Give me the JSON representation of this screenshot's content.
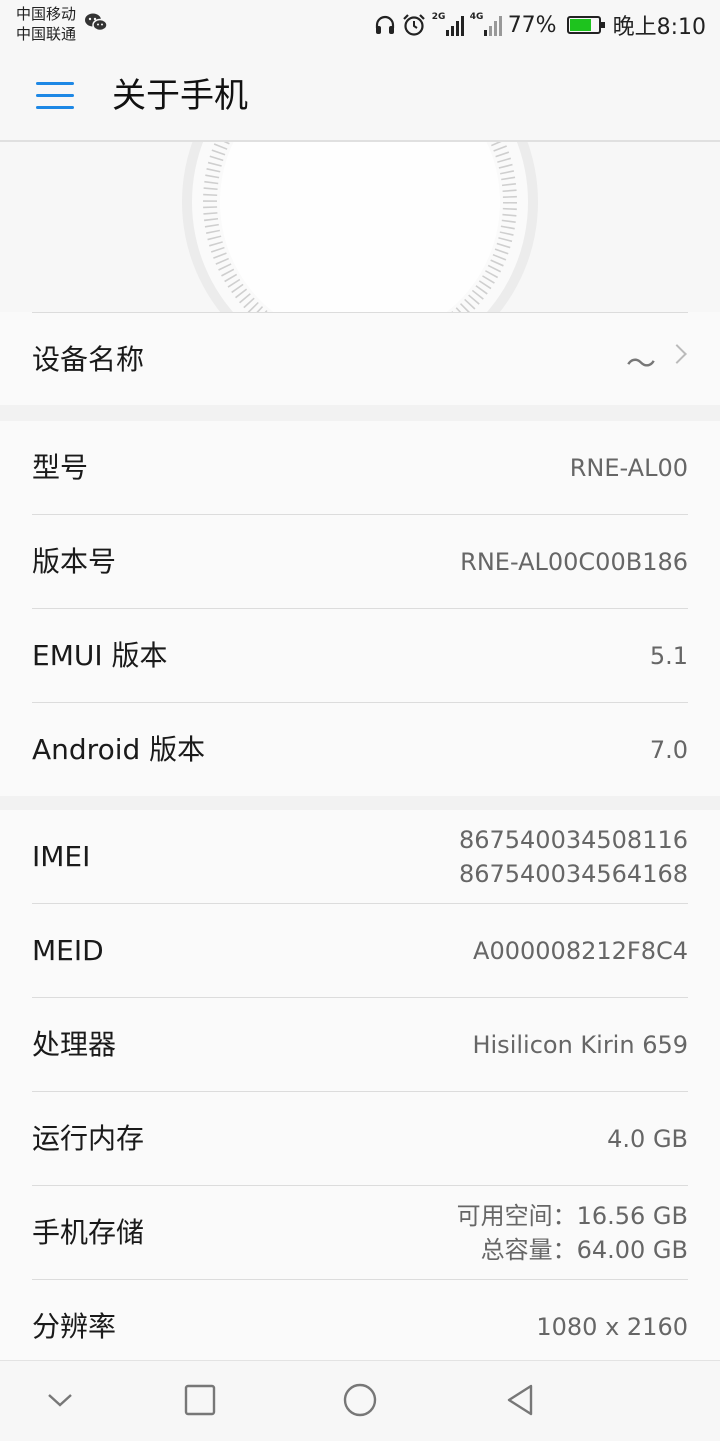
{
  "status_bar": {
    "carrier1": "中国移动",
    "carrier2": "中国联通",
    "signal1_label": "2G",
    "signal2_label": "4G",
    "battery_percent": "77%",
    "battery_level": 0.77,
    "time": "晚上8:10",
    "icons": [
      "wechat-icon",
      "headphones-icon",
      "alarm-icon",
      "signal-icon",
      "battery-icon"
    ]
  },
  "header": {
    "title": "关于手机",
    "menu_icon": "menu-icon"
  },
  "device_name": {
    "label": "设备名称",
    "value": "～"
  },
  "group1": [
    {
      "label": "型号",
      "value": "RNE-AL00"
    },
    {
      "label": "版本号",
      "value": "RNE-AL00C00B186"
    },
    {
      "label": "EMUI 版本",
      "value": "5.1"
    },
    {
      "label": "Android 版本",
      "value": "7.0"
    }
  ],
  "group2": {
    "imei": {
      "label": "IMEI",
      "value1": "867540034508116",
      "value2": "867540034564168"
    },
    "meid": {
      "label": "MEID",
      "value": "A000008212F8C4"
    },
    "processor": {
      "label": "处理器",
      "value": "Hisilicon Kirin 659"
    },
    "ram": {
      "label": "运行内存",
      "value": "4.0 GB"
    },
    "storage": {
      "label": "手机存储",
      "available": "可用空间：16.56  GB",
      "total": "总容量：64.00  GB"
    },
    "resolution": {
      "label": "分辨率",
      "value": "1080 x 2160"
    }
  },
  "nav_bar": {
    "icons": [
      "chevron-down-icon",
      "recents-icon",
      "home-icon",
      "back-icon"
    ]
  },
  "colors": {
    "accent": "#1e88e5",
    "battery": "#1ec31e"
  }
}
